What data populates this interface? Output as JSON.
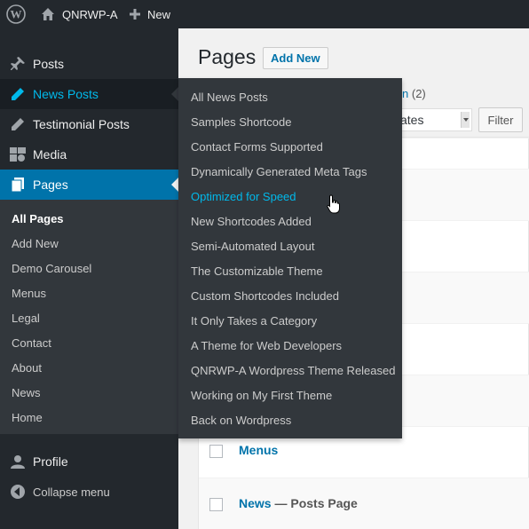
{
  "adminbar": {
    "wp_logo_icon": "wordpress-icon",
    "site_icon": "home-icon",
    "site_name": "QNRWP-A",
    "new_icon": "plus-icon",
    "new_label": "New"
  },
  "sidebar": {
    "items": [
      {
        "label": "Posts",
        "icon": "pushpin-icon"
      },
      {
        "label": "News Posts",
        "icon": "pencil-icon"
      },
      {
        "label": "Testimonial Posts",
        "icon": "pencil-icon"
      },
      {
        "label": "Media",
        "icon": "media-icon"
      },
      {
        "label": "Pages",
        "icon": "pages-icon"
      }
    ],
    "pages_submenu": [
      {
        "label": "All Pages"
      },
      {
        "label": "Add New"
      },
      {
        "label": "Demo Carousel"
      },
      {
        "label": "Menus"
      },
      {
        "label": "Legal"
      },
      {
        "label": "Contact"
      },
      {
        "label": "About"
      },
      {
        "label": "News"
      },
      {
        "label": "Home"
      }
    ],
    "profile": {
      "label": "Profile",
      "icon": "user-icon"
    },
    "collapse": {
      "label": "Collapse menu",
      "icon": "collapse-icon"
    }
  },
  "main": {
    "title": "Pages",
    "add_new": "Add New",
    "subsubsub_link_fragment": "n",
    "subsubsub_count": "(2)",
    "bulk_select_visible_text": "ates",
    "filter_button": "Filter",
    "rows": [
      {
        "title": "Menus",
        "state": ""
      },
      {
        "title": "News",
        "state": " — Posts Page"
      }
    ]
  },
  "flyout": {
    "items": [
      {
        "label": "All News Posts"
      },
      {
        "label": "Samples Shortcode"
      },
      {
        "label": "Contact Forms Supported"
      },
      {
        "label": "Dynamically Generated Meta Tags"
      },
      {
        "label": "Optimized for Speed"
      },
      {
        "label": "New Shortcodes Added"
      },
      {
        "label": "Semi-Automated Layout"
      },
      {
        "label": "The Customizable Theme"
      },
      {
        "label": "Custom Shortcodes Included"
      },
      {
        "label": "It Only Takes a Category"
      },
      {
        "label": "A Theme for Web Developers"
      },
      {
        "label": "QNRWP-A Wordpress Theme Released"
      },
      {
        "label": "Working on My First Theme"
      },
      {
        "label": "Back on Wordpress"
      }
    ],
    "hovered_index": 4
  },
  "colors": {
    "adminbar_bg": "#23282d",
    "sidebar_bg": "#23282d",
    "submenu_bg": "#32373c",
    "active_blue": "#0073aa",
    "hover_cyan": "#00b9eb"
  }
}
